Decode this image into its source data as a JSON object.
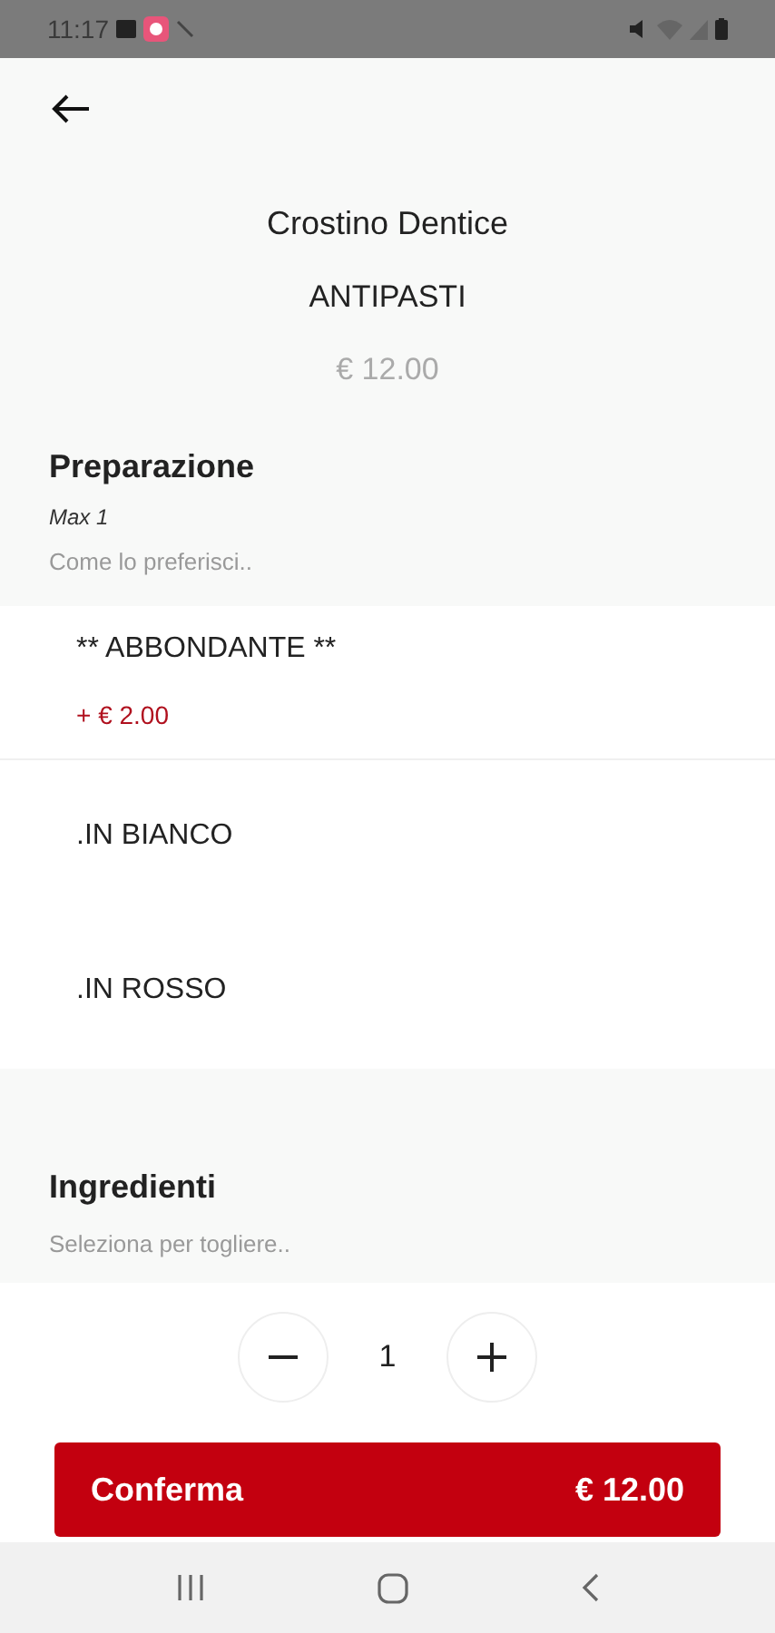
{
  "status_bar": {
    "time": "11:17"
  },
  "product": {
    "name": "Crostino Dentice",
    "category": "ANTIPASTI",
    "price": "€ 12.00"
  },
  "preparation": {
    "title": "Preparazione",
    "limit": "Max 1",
    "hint": "Come lo preferisci..",
    "options": [
      {
        "label": "** ABBONDANTE **",
        "extra": "+ € 2.00"
      },
      {
        "label": ".IN BIANCO"
      },
      {
        "label": ".IN ROSSO"
      }
    ]
  },
  "ingredients": {
    "title": "Ingredienti",
    "hint": "Seleziona per togliere.."
  },
  "quantity": "1",
  "confirm": {
    "label": "Conferma",
    "total": "€ 12.00"
  }
}
